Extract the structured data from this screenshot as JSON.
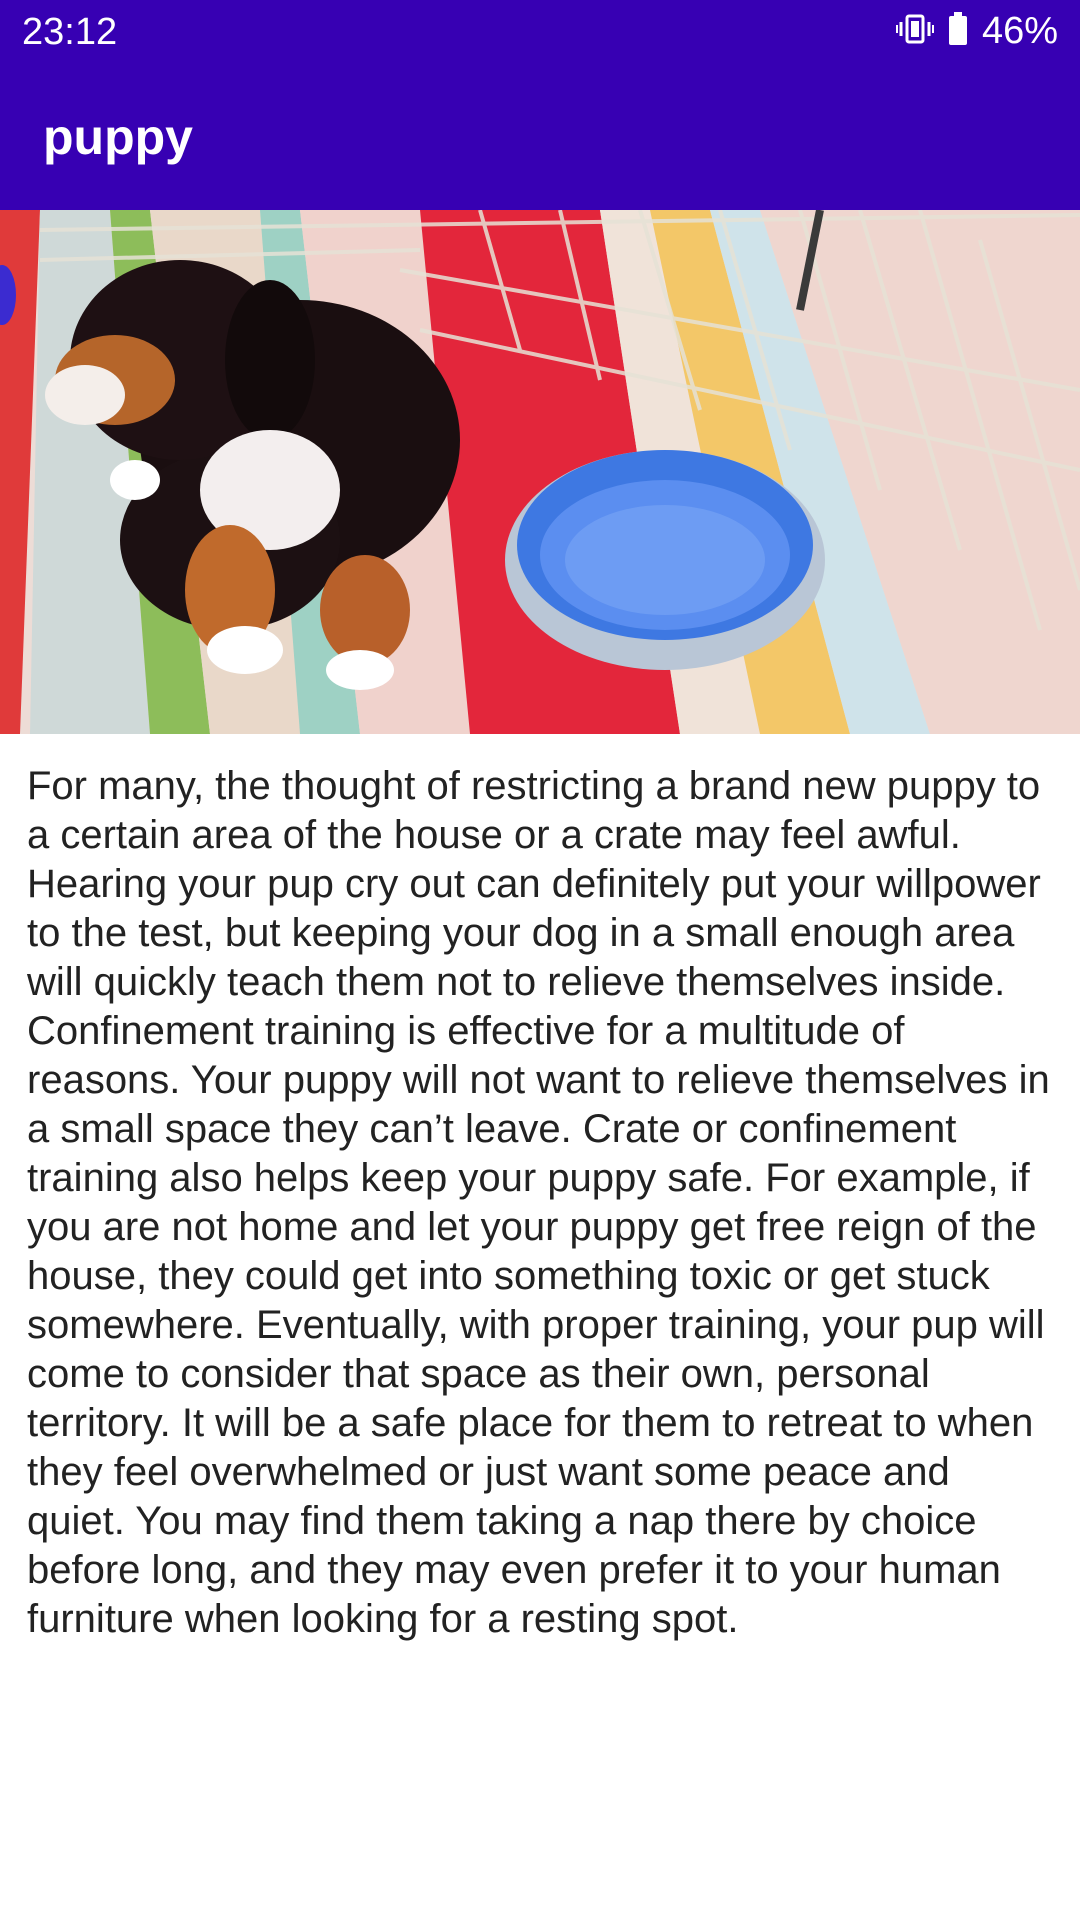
{
  "status_bar": {
    "time": "23:12",
    "battery_percent": "46%",
    "icons": [
      "vibrate-icon",
      "battery-icon"
    ]
  },
  "app_bar": {
    "title": "puppy",
    "color": "#3700b3"
  },
  "hero_image": {
    "subject": "puppy-in-pen-with-water-bowl"
  },
  "article": {
    "body": "For many, the thought of restricting a brand new puppy to a certain area of the house or a crate may feel awful. Hearing your pup cry out can definitely put your willpower to the test, but keeping your dog in a small enough area will quickly teach them not to relieve themselves inside. Confinement training is effective for a multitude of reasons. Your puppy will not want to relieve themselves in a small space they can’t leave. Crate or confinement training also helps keep your puppy safe. For example, if you are not home and let your puppy get free reign of the house, they could get into something toxic or get stuck somewhere. Eventually, with proper training, your pup will come to consider that space as their own, personal territory. It will be a safe place for them to retreat to when they feel overwhelmed or just want some peace and quiet. You may find them taking a nap there by choice before long, and they may even prefer it to your human furniture when looking for a resting spot."
  }
}
